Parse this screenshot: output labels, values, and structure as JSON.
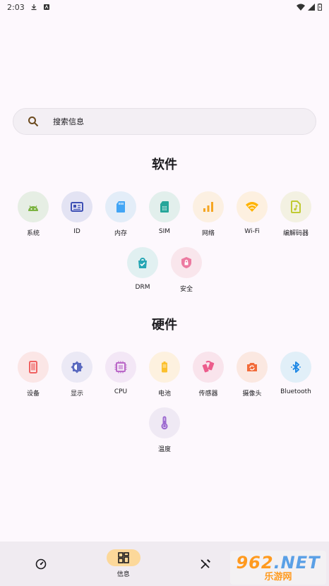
{
  "status_bar": {
    "time": "2:03"
  },
  "search": {
    "placeholder": "搜索信息"
  },
  "software": {
    "title": "软件",
    "items": [
      {
        "label": "系统",
        "icon": "android-icon",
        "bg": "#e6eee4",
        "fg": "#7cb342"
      },
      {
        "label": "ID",
        "icon": "id-card-icon",
        "bg": "#e3e3f3",
        "fg": "#3f51b5"
      },
      {
        "label": "内存",
        "icon": "sd-card-icon",
        "bg": "#e3edf8",
        "fg": "#42a5f5"
      },
      {
        "label": "SIM",
        "icon": "sim-card-icon",
        "bg": "#e2efec",
        "fg": "#26a69a"
      },
      {
        "label": "网络",
        "icon": "signal-icon",
        "bg": "#fcf0e2",
        "fg": "#f5a623"
      },
      {
        "label": "Wi-Fi",
        "icon": "wifi-icon",
        "bg": "#fdf0e0",
        "fg": "#ffb300"
      },
      {
        "label": "编解码器",
        "icon": "audio-file-icon",
        "bg": "#f3f1e2",
        "fg": "#c0ca33"
      },
      {
        "label": "DRM",
        "icon": "shopping-bag-check-icon",
        "bg": "#e1f0f1",
        "fg": "#26a6b4"
      },
      {
        "label": "安全",
        "icon": "shield-lock-icon",
        "bg": "#f9e6ec",
        "fg": "#ec7aa0"
      }
    ]
  },
  "hardware": {
    "title": "硬件",
    "items": [
      {
        "label": "设备",
        "icon": "phone-icon",
        "bg": "#fbe6e6",
        "fg": "#f06262"
      },
      {
        "label": "显示",
        "icon": "brightness-icon",
        "bg": "#ebe9f5",
        "fg": "#5c6bc0"
      },
      {
        "label": "CPU",
        "icon": "cpu-chip-icon",
        "bg": "#f3e7f6",
        "fg": "#ba68c8"
      },
      {
        "label": "电池",
        "icon": "battery-icon",
        "bg": "#fdf1df",
        "fg": "#fbc02d"
      },
      {
        "label": "传感器",
        "icon": "screen-rotation-icon",
        "bg": "#f9e4ec",
        "fg": "#ec5c8c"
      },
      {
        "label": "摄像头",
        "icon": "camera-rotate-icon",
        "bg": "#fbe8e1",
        "fg": "#f26b3a"
      },
      {
        "label": "Bluetooth",
        "icon": "bluetooth-icon",
        "bg": "#e1eff8",
        "fg": "#1e88e5"
      },
      {
        "label": "温度",
        "icon": "thermometer-icon",
        "bg": "#efe9f4",
        "fg": "#9c6ad0"
      }
    ]
  },
  "bottom_nav": {
    "items": [
      {
        "label": "",
        "icon": "speedometer-icon"
      },
      {
        "label": "信息",
        "icon": "dashboard-grid-icon",
        "active": true
      },
      {
        "label": "",
        "icon": "tools-icon"
      },
      {
        "label": "",
        "icon": "settings-icon"
      }
    ]
  },
  "watermark": {
    "line1": "962",
    "line1b": ".NET",
    "line2": "乐游网"
  },
  "colors": {
    "background": "#fdf8fd",
    "nav_bg": "#f0ebf1",
    "active_pill": "#fcd89a"
  }
}
